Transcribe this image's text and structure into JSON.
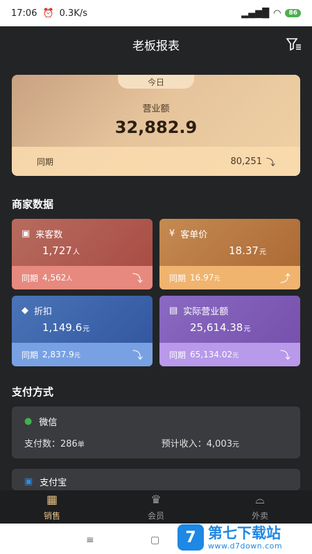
{
  "status": {
    "time": "17:06",
    "speed": "0.3K/s",
    "battery": "86"
  },
  "nav": {
    "title": "老板报表"
  },
  "summary": {
    "tab": "今日",
    "label": "营业额",
    "value": "32,882.9",
    "compare_label": "同期",
    "compare_value": "80,251"
  },
  "merchant": {
    "title": "商家数据",
    "cards": [
      {
        "name": "来客数",
        "value": "1,727",
        "unit": "人",
        "compare_label": "同期",
        "compare_value": "4,562",
        "compare_unit": "人",
        "trend": "down"
      },
      {
        "name": "客单价",
        "value": "18.37",
        "unit": "元",
        "compare_label": "同期",
        "compare_value": "16.97",
        "compare_unit": "元",
        "trend": "up"
      },
      {
        "name": "折扣",
        "value": "1,149.6",
        "unit": "元",
        "compare_label": "同期",
        "compare_value": "2,837.9",
        "compare_unit": "元",
        "trend": "down"
      },
      {
        "name": "实际营业额",
        "value": "25,614.38",
        "unit": "元",
        "compare_label": "同期",
        "compare_value": "65,134.02",
        "compare_unit": "元",
        "trend": "down"
      }
    ]
  },
  "payment": {
    "title": "支付方式",
    "methods": [
      {
        "name": "微信",
        "count_label": "支付数：",
        "count": "286",
        "count_unit": "单",
        "income_label": "预计收入：",
        "income": "4,003",
        "income_unit": "元"
      },
      {
        "name": "支付宝"
      }
    ]
  },
  "tabs": [
    {
      "label": "销售",
      "active": true
    },
    {
      "label": "会员",
      "active": false
    },
    {
      "label": "外卖",
      "active": false
    }
  ],
  "watermark": {
    "brand": "第七下载站",
    "url": "www.d7down.com",
    "logo_letter": "7"
  },
  "colors": {
    "accent": "#e6c082",
    "background": "#232426"
  }
}
